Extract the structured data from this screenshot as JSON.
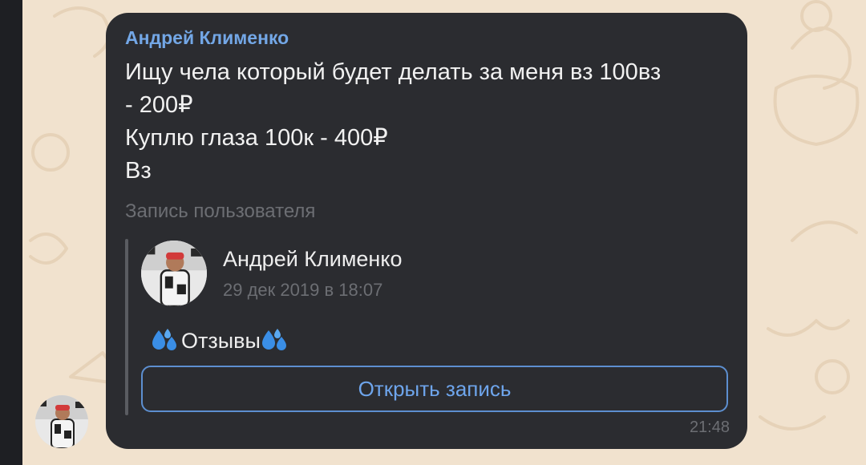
{
  "message": {
    "sender": "Андрей Клименко",
    "text_lines": [
      "Ищу чела который будет делать за меня вз 100вз",
      "- 200₽",
      "Куплю глаза 100к - 400₽",
      "Вз"
    ],
    "time": "21:48"
  },
  "repost": {
    "label": "Запись пользователя",
    "author": "Андрей Клименко",
    "date": "29 дек 2019 в 18:07",
    "text": "Отзывы",
    "button_label": "Открыть запись"
  },
  "colors": {
    "chat_background": "#f1e2ce",
    "bubble": "#2b2c30",
    "sender_name": "#73a7e6",
    "button_accent": "#6ea5ec",
    "secondary_text": "#6c6e73"
  },
  "icons": {
    "repost_text_prefix": "sweat-droplets-icon",
    "repost_text_suffix": "sweat-droplets-icon"
  }
}
